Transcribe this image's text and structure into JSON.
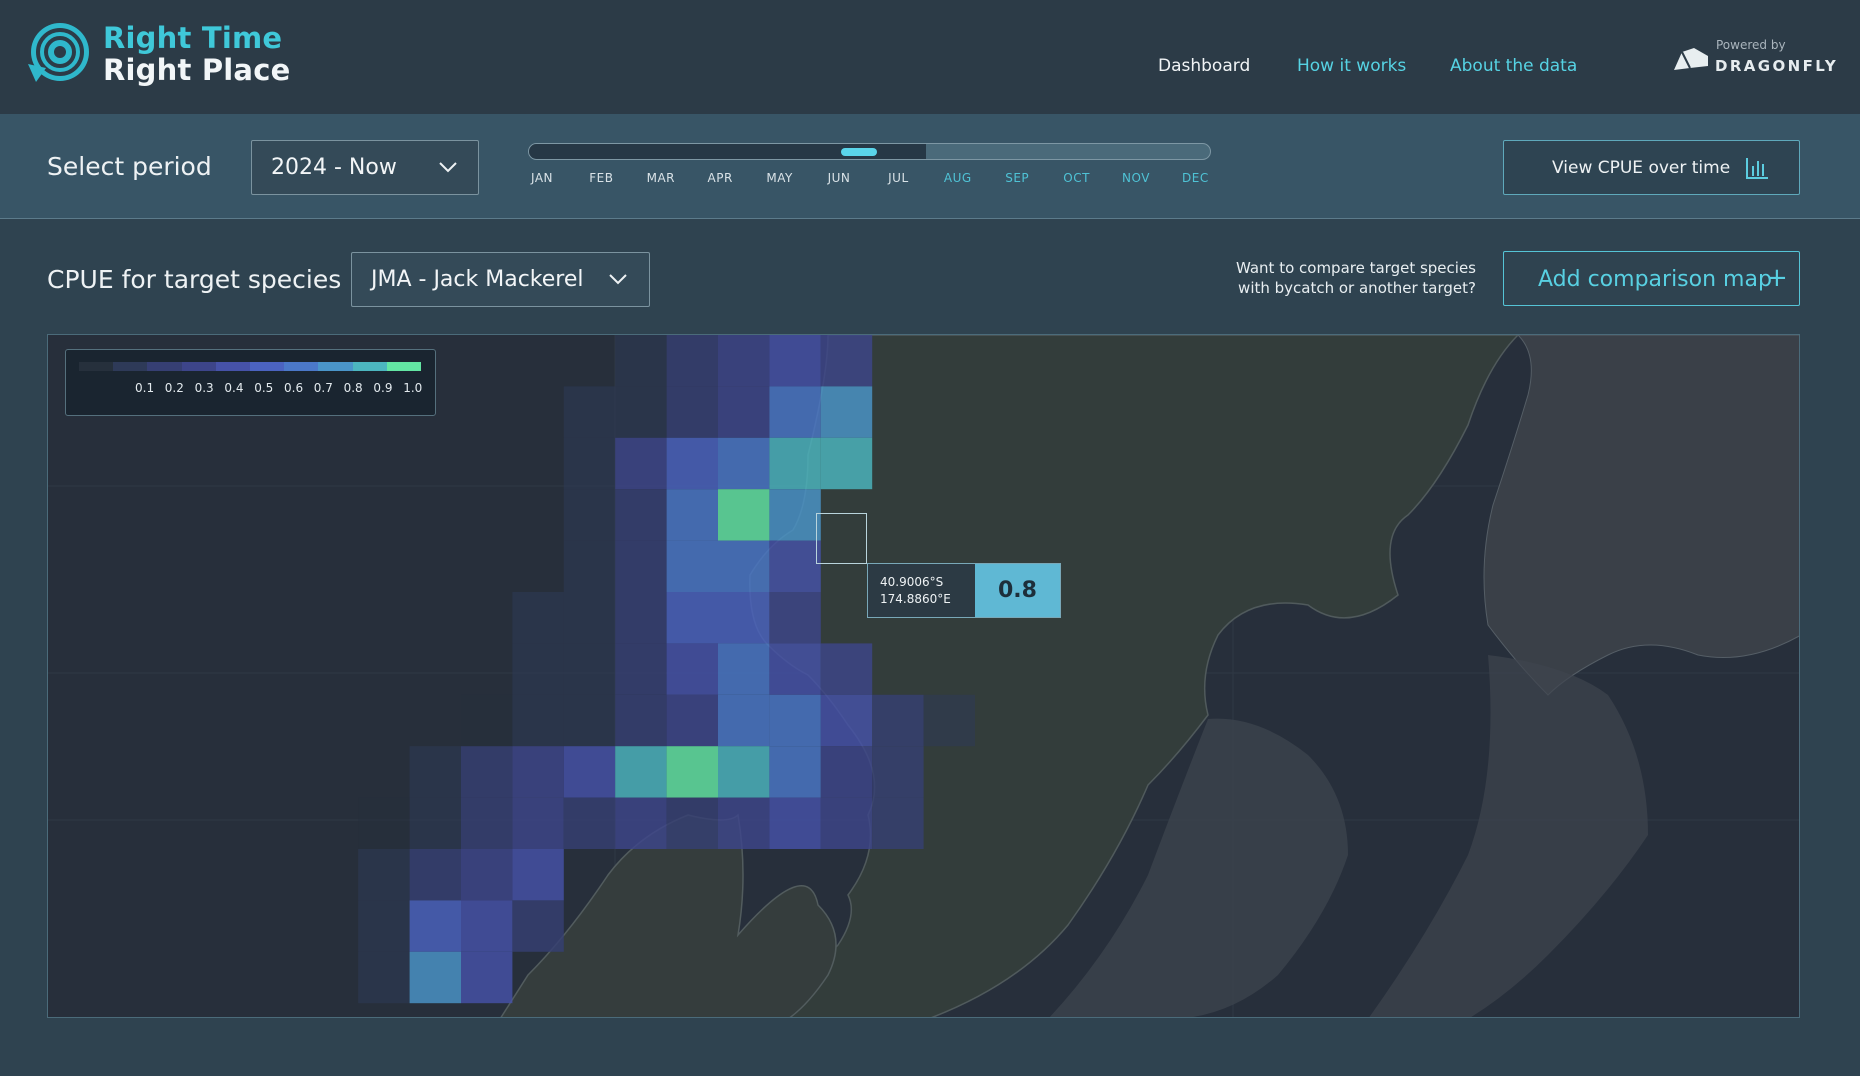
{
  "brand": {
    "line1": "Right Time",
    "line2": "Right Place",
    "accent": "#3fc8d9",
    "icon": "fish-spiral-logo-icon"
  },
  "nav": {
    "dashboard": "Dashboard",
    "how_it_works": "How it works",
    "about": "About the data"
  },
  "powered_by": {
    "label": "Powered by",
    "name": "DRAGONFLY",
    "icon": "dragonfly-logo-icon"
  },
  "period": {
    "label": "Select period",
    "selected": "2024 - Now",
    "months": [
      "JAN",
      "FEB",
      "MAR",
      "APR",
      "MAY",
      "JUN",
      "JUL",
      "AUG",
      "SEP",
      "OCT",
      "NOV",
      "DEC"
    ],
    "available_through_month": 7,
    "slider_month": "JUN",
    "view_cpue_label": "View CPUE over time",
    "view_cpue_icon": "bar-chart-icon"
  },
  "species": {
    "label": "CPUE for target species",
    "selected": "JMA - Jack Mackerel",
    "compare_text_line1": "Want to compare target species",
    "compare_text_line2": "with bycatch or another target?",
    "add_comparison_label": "Add comparison map",
    "add_icon": "plus-icon"
  },
  "legend": {
    "ticks": [
      "0.1",
      "0.2",
      "0.3",
      "0.4",
      "0.5",
      "0.6",
      "0.7",
      "0.8",
      "0.9",
      "1.0"
    ],
    "colors": [
      "#26303c",
      "#2e3a58",
      "#363f73",
      "#3d458a",
      "#4652a8",
      "#4b63c0",
      "#4b78c8",
      "#4a95c9",
      "#4cb6bf",
      "#63e6a3"
    ]
  },
  "tooltip": {
    "lat": "40.9006°S",
    "lon": "174.8860°E",
    "value": "0.8"
  }
}
